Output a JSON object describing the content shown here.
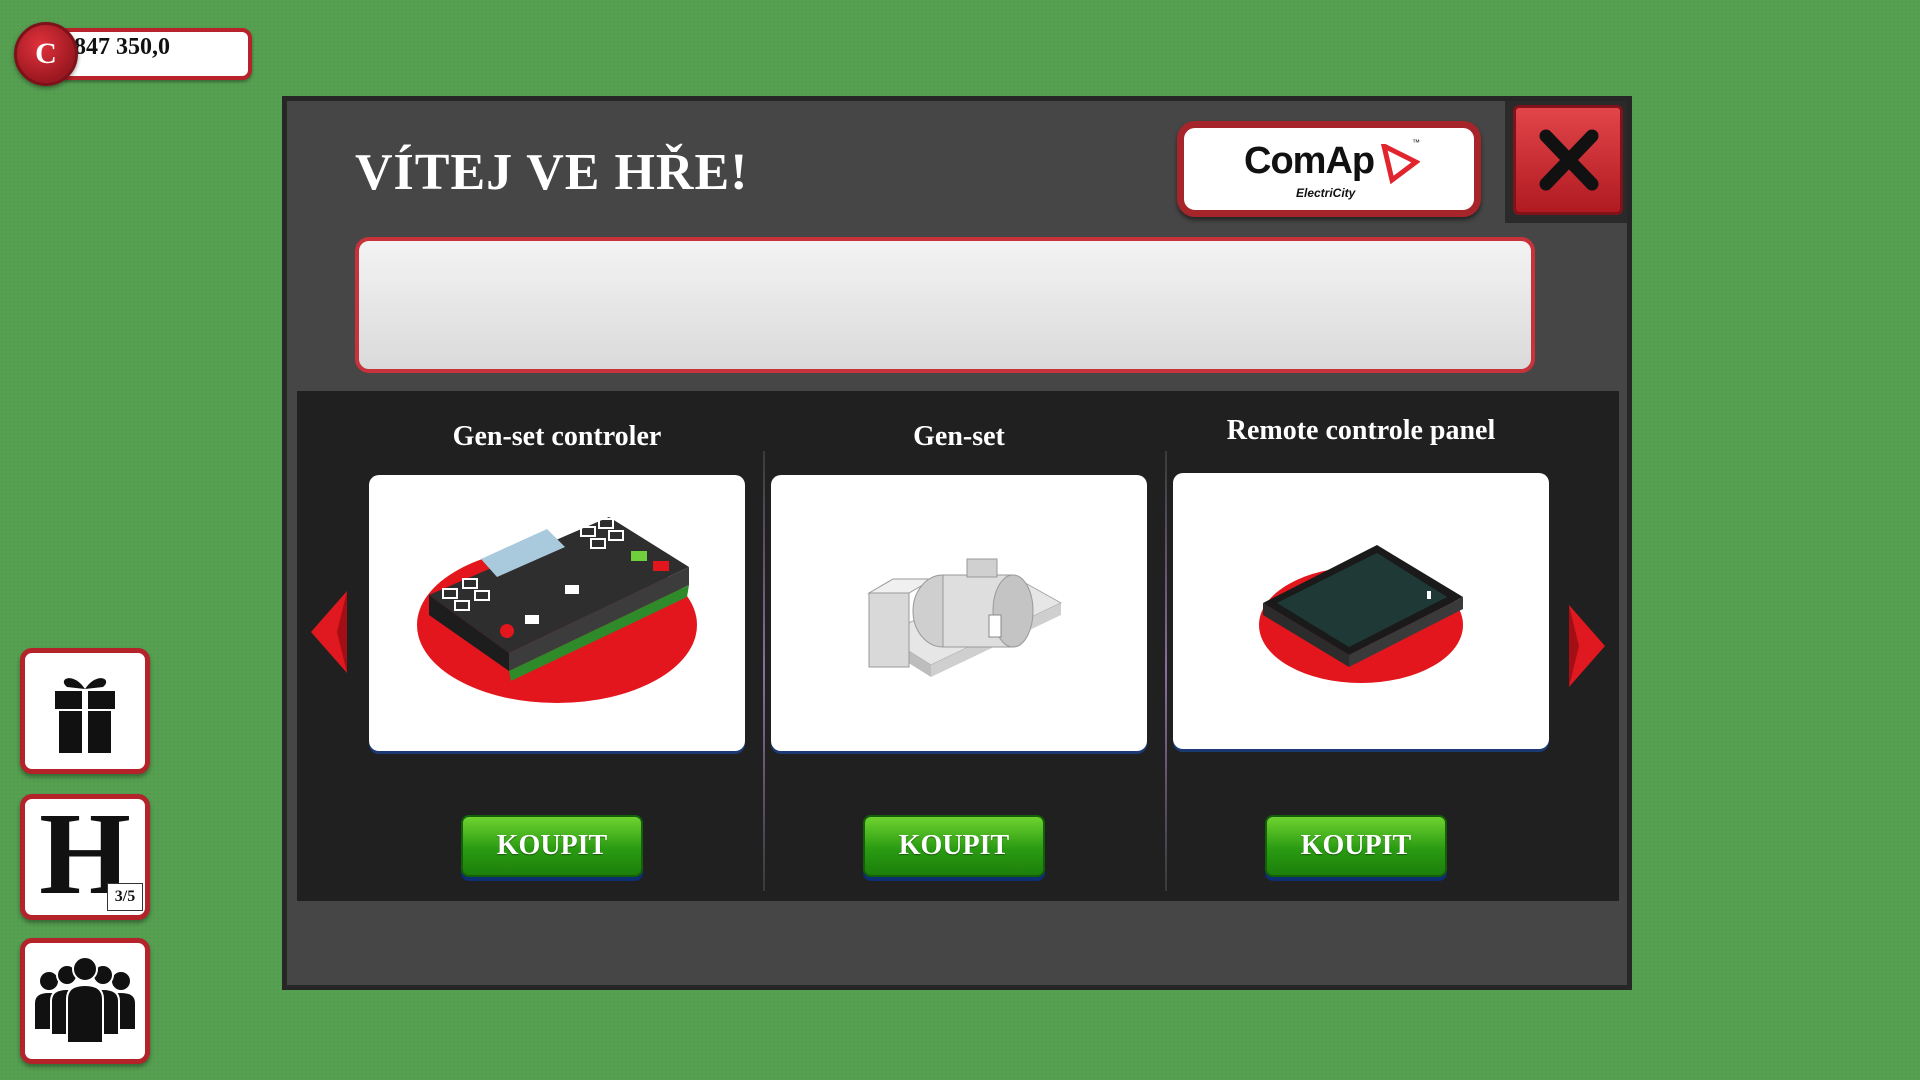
{
  "currency": {
    "symbol": "C",
    "amount": "847 350,0"
  },
  "side_buttons": {
    "hints_badge": "3/5",
    "hints_letter": "H"
  },
  "dialog": {
    "title": "VÍTEJ VE HŘE!",
    "logo": {
      "name": "ComAp",
      "tagline": "ElectriCity",
      "tm": "™"
    },
    "message": ""
  },
  "shop": {
    "items": [
      {
        "title": "Gen-set controler",
        "button": "KOUPIT",
        "icon": "genset-controller-icon"
      },
      {
        "title": "Gen-set",
        "button": "KOUPIT",
        "icon": "genset-icon"
      },
      {
        "title": "Remote controle panel",
        "button": "KOUPIT",
        "icon": "remote-panel-icon"
      }
    ]
  },
  "colors": {
    "accent_red": "#b8232b",
    "buy_green": "#2a9b12",
    "felt_green": "#56a051"
  }
}
